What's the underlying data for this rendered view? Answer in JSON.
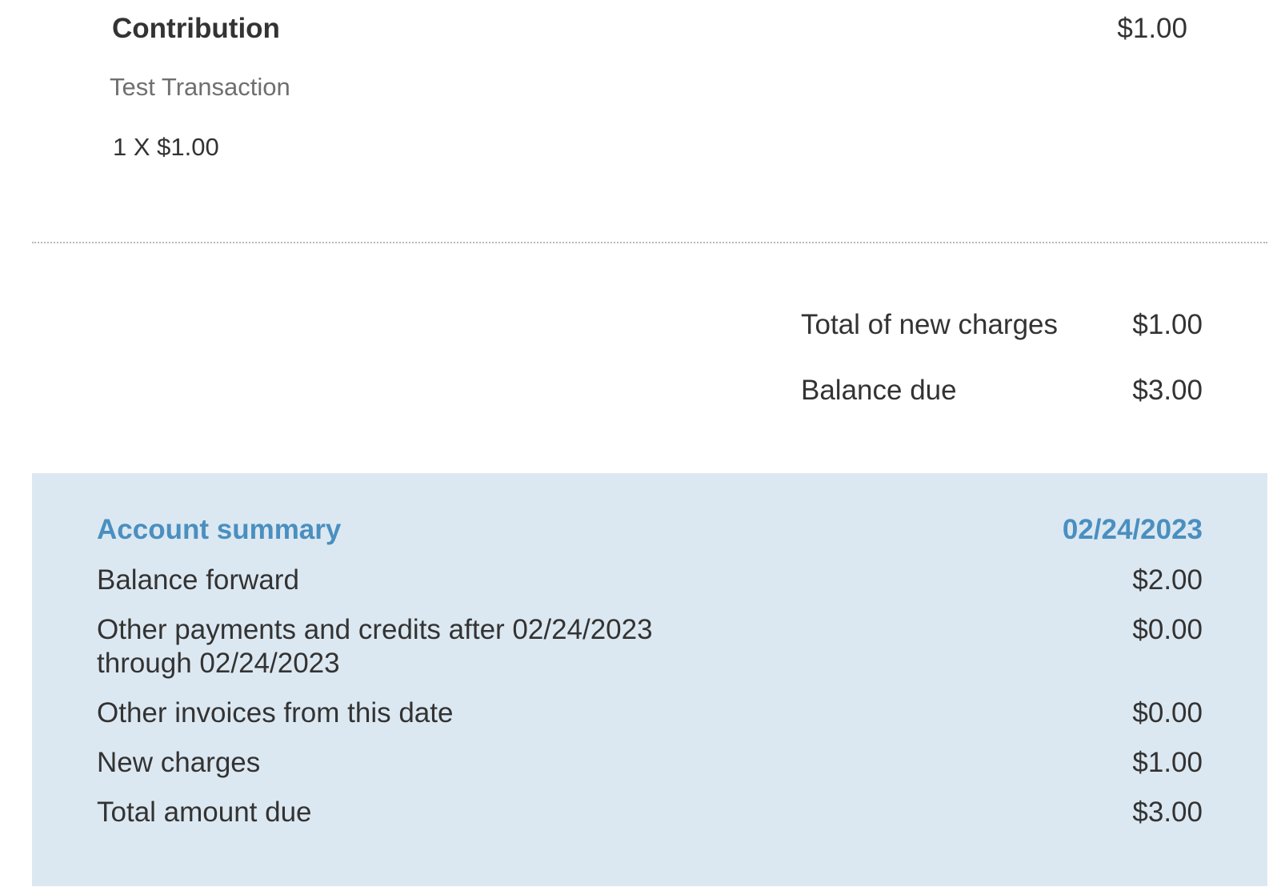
{
  "line_item": {
    "title": "Contribution",
    "amount": "$1.00",
    "description": "Test Transaction",
    "quantity_text": "1 X $1.00"
  },
  "totals": [
    {
      "label": "Total of new charges",
      "value": "$1.00"
    },
    {
      "label": "Balance due",
      "value": "$3.00"
    }
  ],
  "account_summary": {
    "title": "Account summary",
    "date": "02/24/2023",
    "rows": [
      {
        "label": "Balance forward",
        "value": "$2.00"
      },
      {
        "label": "Other payments and credits after 02/24/2023 through 02/24/2023",
        "value": "$0.00"
      },
      {
        "label": "Other invoices from this date",
        "value": "$0.00"
      },
      {
        "label": "New charges",
        "value": "$1.00"
      },
      {
        "label": "Total amount due",
        "value": "$3.00"
      }
    ]
  },
  "colors": {
    "summary_background": "#dce8f1",
    "summary_accent": "#4a8fc0",
    "text": "#333333",
    "muted_text": "#6f6f6f"
  }
}
